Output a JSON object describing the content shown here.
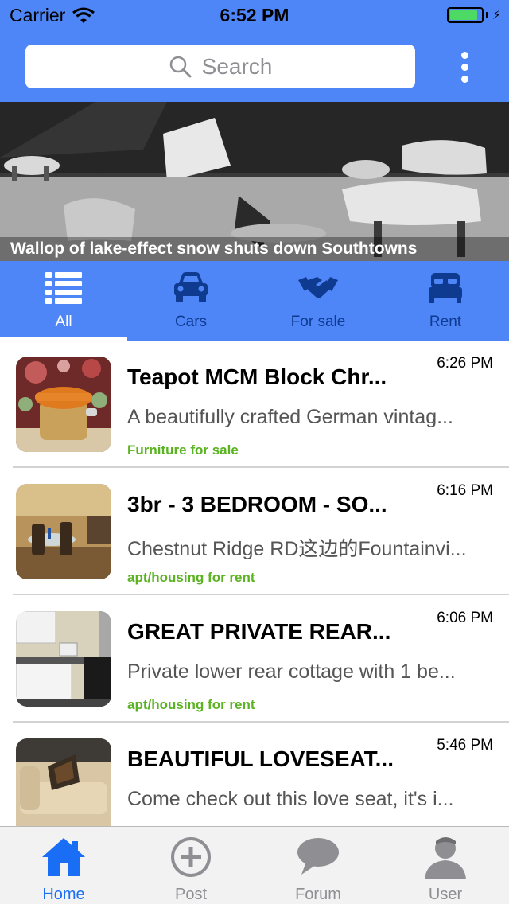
{
  "status_bar": {
    "carrier": "Carrier",
    "time": "6:52 PM",
    "battery_level": 0.9
  },
  "header": {
    "search_placeholder": "Search"
  },
  "banner": {
    "caption": "Wallop of lake-effect snow shuts down Southtowns"
  },
  "categories": [
    {
      "label": "All",
      "icon": "list-icon",
      "active": true
    },
    {
      "label": "Cars",
      "icon": "car-icon",
      "active": false
    },
    {
      "label": "For sale",
      "icon": "handshake-icon",
      "active": false
    },
    {
      "label": "Rent",
      "icon": "bed-icon",
      "active": false
    }
  ],
  "listings": [
    {
      "title": "Teapot MCM Block Chr...",
      "time": "6:26 PM",
      "description": "A beautifully crafted German vintag...",
      "category": "Furniture for sale"
    },
    {
      "title": "3br - 3 BEDROOM - SO...",
      "time": "6:16 PM",
      "description": "Chestnut Ridge RD这边的Fountainvi...",
      "category": "apt/housing for rent"
    },
    {
      "title": "GREAT PRIVATE REAR...",
      "time": "6:06 PM",
      "description": "Private lower rear cottage with 1 be...",
      "category": "apt/housing for rent"
    },
    {
      "title": "BEAUTIFUL LOVESEAT...",
      "time": "5:46 PM",
      "description": "Come check out this love seat, it's i...",
      "category": ""
    }
  ],
  "tab_bar": [
    {
      "label": "Home",
      "icon": "home-icon",
      "active": true
    },
    {
      "label": "Post",
      "icon": "plus-circle-icon",
      "active": false
    },
    {
      "label": "Forum",
      "icon": "chat-bubble-icon",
      "active": false
    },
    {
      "label": "User",
      "icon": "user-icon",
      "active": false
    }
  ],
  "colors": {
    "brand_blue": "#4f86f7",
    "category_green": "#5ab320",
    "tab_active": "#1a6ef5",
    "tab_inactive": "#8e8e93"
  }
}
